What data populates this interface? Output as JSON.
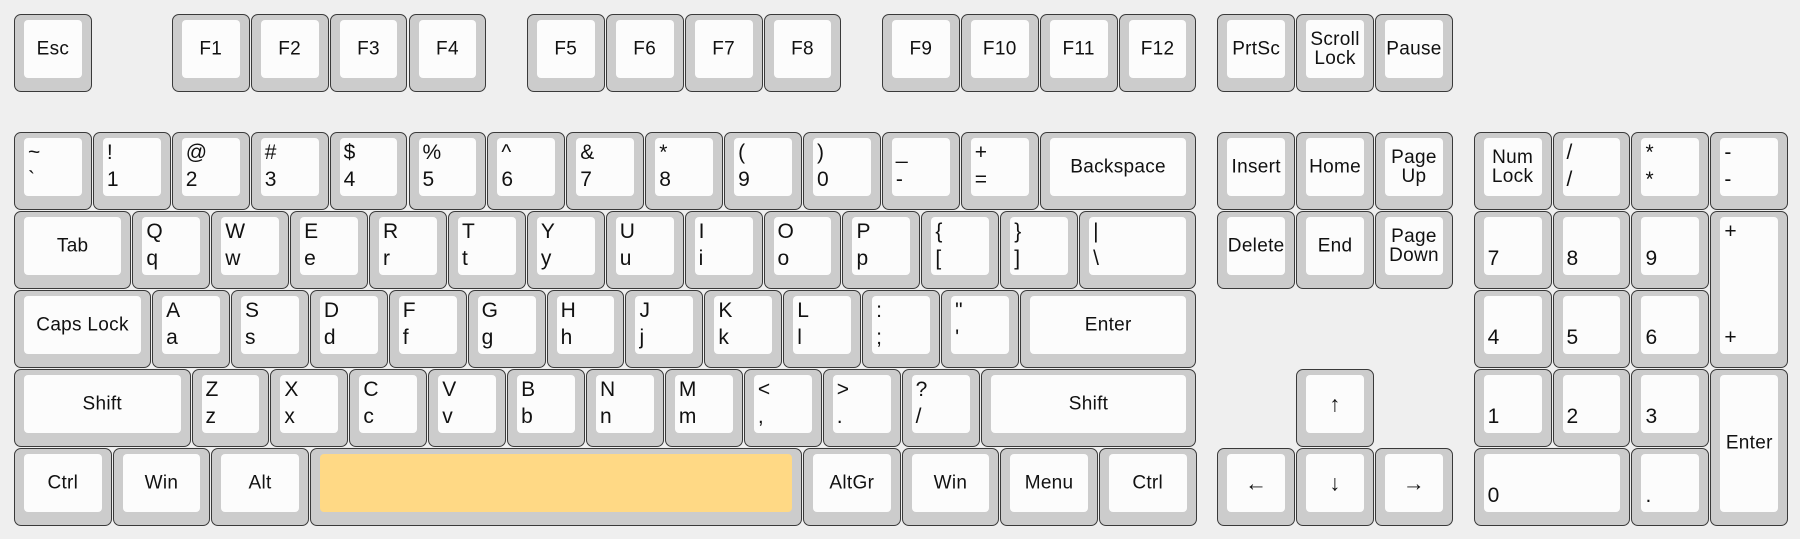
{
  "colors": {
    "background": "#efefef",
    "key_base": "#cccccc",
    "key_cap": "#fcfcfc",
    "highlighted_key": "#ffd985"
  },
  "highlighted": "Space",
  "keys": [
    {
      "label": "Esc"
    },
    {
      "label": "F1"
    },
    {
      "label": "F2"
    },
    {
      "label": "F3"
    },
    {
      "label": "F4"
    },
    {
      "label": "F5"
    },
    {
      "label": "F6"
    },
    {
      "label": "F7"
    },
    {
      "label": "F8"
    },
    {
      "label": "F9"
    },
    {
      "label": "F10"
    },
    {
      "label": "F11"
    },
    {
      "label": "F12"
    },
    {
      "label": "PrtSc"
    },
    {
      "label": "Scroll\nLock"
    },
    {
      "label": "Pause"
    },
    {
      "shift": "~",
      "base": "`"
    },
    {
      "shift": "!",
      "base": "1"
    },
    {
      "shift": "@",
      "base": "2"
    },
    {
      "shift": "#",
      "base": "3"
    },
    {
      "shift": "$",
      "base": "4"
    },
    {
      "shift": "%",
      "base": "5"
    },
    {
      "shift": "^",
      "base": "6"
    },
    {
      "shift": "&",
      "base": "7"
    },
    {
      "shift": "*",
      "base": "8"
    },
    {
      "shift": "(",
      "base": "9"
    },
    {
      "shift": ")",
      "base": "0"
    },
    {
      "shift": "_",
      "base": "-"
    },
    {
      "shift": "+",
      "base": "="
    },
    {
      "label": "Backspace"
    },
    {
      "label": "Insert"
    },
    {
      "label": "Home"
    },
    {
      "label": "Page\nUp"
    },
    {
      "label": "Num\nLock"
    },
    {
      "shift": "/",
      "base": "/"
    },
    {
      "shift": "*",
      "base": "*"
    },
    {
      "shift": "-",
      "base": "-"
    },
    {
      "label": "Tab"
    },
    {
      "shift": "Q",
      "base": "q"
    },
    {
      "shift": "W",
      "base": "w"
    },
    {
      "shift": "E",
      "base": "e"
    },
    {
      "shift": "R",
      "base": "r"
    },
    {
      "shift": "T",
      "base": "t"
    },
    {
      "shift": "Y",
      "base": "y"
    },
    {
      "shift": "U",
      "base": "u"
    },
    {
      "shift": "I",
      "base": "i"
    },
    {
      "shift": "O",
      "base": "o"
    },
    {
      "shift": "P",
      "base": "p"
    },
    {
      "shift": "{",
      "base": "["
    },
    {
      "shift": "}",
      "base": "]"
    },
    {
      "shift": "|",
      "base": "\\"
    },
    {
      "label": "Delete"
    },
    {
      "label": "End"
    },
    {
      "label": "Page\nDown"
    },
    {
      "base": "7"
    },
    {
      "base": "8"
    },
    {
      "base": "9"
    },
    {
      "shift": "+",
      "base": "+"
    },
    {
      "label": "Caps Lock"
    },
    {
      "shift": "A",
      "base": "a"
    },
    {
      "shift": "S",
      "base": "s"
    },
    {
      "shift": "D",
      "base": "d"
    },
    {
      "shift": "F",
      "base": "f"
    },
    {
      "shift": "G",
      "base": "g"
    },
    {
      "shift": "H",
      "base": "h"
    },
    {
      "shift": "J",
      "base": "j"
    },
    {
      "shift": "K",
      "base": "k"
    },
    {
      "shift": "L",
      "base": "l"
    },
    {
      "shift": ":",
      "base": ";"
    },
    {
      "shift": "\"",
      "base": "'"
    },
    {
      "label": "Enter"
    },
    {
      "base": "4"
    },
    {
      "base": "5"
    },
    {
      "base": "6"
    },
    {
      "label": "Shift"
    },
    {
      "shift": "Z",
      "base": "z"
    },
    {
      "shift": "X",
      "base": "x"
    },
    {
      "shift": "C",
      "base": "c"
    },
    {
      "shift": "V",
      "base": "v"
    },
    {
      "shift": "B",
      "base": "b"
    },
    {
      "shift": "N",
      "base": "n"
    },
    {
      "shift": "M",
      "base": "m"
    },
    {
      "shift": "<",
      "base": ","
    },
    {
      "shift": ">",
      "base": "."
    },
    {
      "shift": "?",
      "base": "/"
    },
    {
      "label": "Shift"
    },
    {
      "label": "↑"
    },
    {
      "base": "1"
    },
    {
      "base": "2"
    },
    {
      "base": "3"
    },
    {
      "label": "Enter"
    },
    {
      "label": "Ctrl"
    },
    {
      "label": "Win"
    },
    {
      "label": "Alt"
    },
    {
      "label": "",
      "name": "Space"
    },
    {
      "label": "AltGr"
    },
    {
      "label": "Win"
    },
    {
      "label": "Menu"
    },
    {
      "label": "Ctrl"
    },
    {
      "label": "←"
    },
    {
      "label": "↓"
    },
    {
      "label": "→"
    },
    {
      "base": "0"
    },
    {
      "base": "."
    }
  ]
}
